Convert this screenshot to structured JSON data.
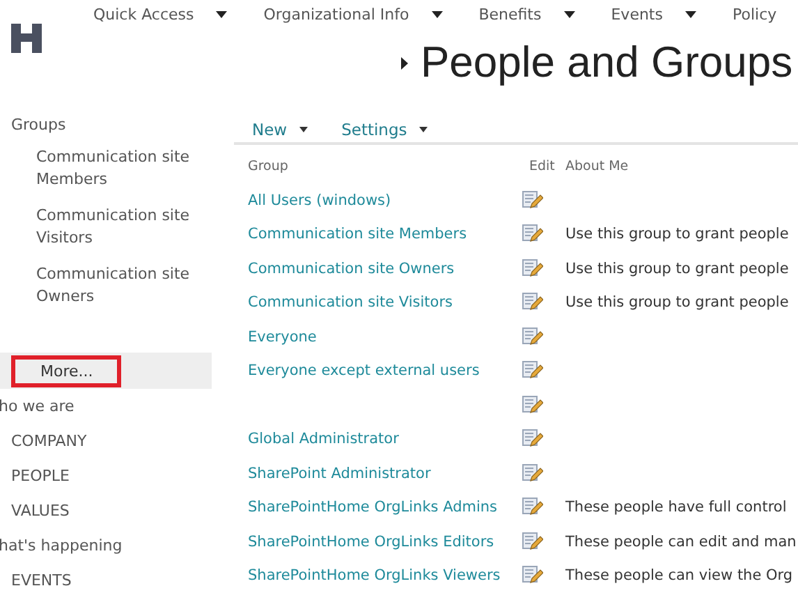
{
  "top_nav": [
    {
      "label": "Quick Access",
      "has_menu": true
    },
    {
      "label": "Organizational Info",
      "has_menu": true
    },
    {
      "label": "Benefits",
      "has_menu": true
    },
    {
      "label": "Events",
      "has_menu": true
    },
    {
      "label": "Policy",
      "has_menu": false
    }
  ],
  "page_title": "People and Groups",
  "sidebar": {
    "heading": "Groups",
    "groups": [
      "Communication site Members",
      "Communication site Visitors",
      "Communication site Owners"
    ],
    "more": {
      "label": "More...",
      "highlighted": true
    },
    "sections": [
      {
        "heading": "ho we are",
        "items": [
          "COMPANY",
          "PEOPLE",
          "VALUES"
        ]
      },
      {
        "heading": "hat's happening",
        "items": [
          "EVENTS"
        ]
      }
    ]
  },
  "toolbar": [
    {
      "label": "New"
    },
    {
      "label": "Settings"
    }
  ],
  "table": {
    "columns": [
      "Group",
      "Edit",
      "About Me"
    ],
    "rows": [
      {
        "group": "All Users (windows)"
      },
      {
        "group": "Communication site Members",
        "about": "Use this group to grant people"
      },
      {
        "group": "Communication site Owners",
        "about": "Use this group to grant people"
      },
      {
        "group": "Communication site Visitors",
        "about": "Use this group to grant people"
      },
      {
        "group": "Everyone"
      },
      {
        "group": "Everyone except external users"
      },
      {},
      {
        "group": "Global Administrator"
      },
      {
        "group": "SharePoint Administrator"
      },
      {
        "group": "SharePointHome OrgLinks Admins",
        "about": "These people have full control"
      },
      {
        "group": "SharePointHome OrgLinks Editors",
        "about": "These people can edit and man"
      },
      {
        "group": "SharePointHome OrgLinks Viewers",
        "about": "These people can view the Org"
      }
    ]
  }
}
